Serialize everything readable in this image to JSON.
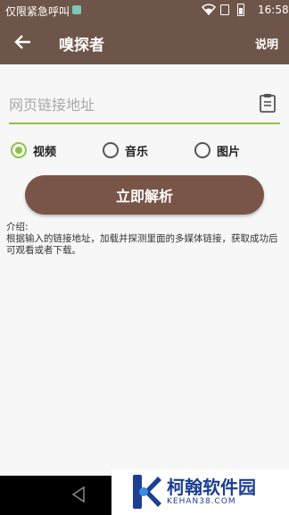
{
  "statusbar": {
    "carrier": "仅限紧急呼叫",
    "time": "16:58"
  },
  "appbar": {
    "title": "嗅探者",
    "help_label": "说明"
  },
  "url_field": {
    "placeholder": "网页链接地址",
    "value": ""
  },
  "media_types": [
    {
      "label": "视频",
      "checked": true
    },
    {
      "label": "音乐",
      "checked": false
    },
    {
      "label": "图片",
      "checked": false
    }
  ],
  "parse_button_label": "立即解析",
  "intro": {
    "heading": "介绍:",
    "body": "根据输入的链接地址，加载并探测里面的多媒体链接，获取成功后可观看或者下载。"
  },
  "watermark": {
    "name": "柯翰软件园",
    "url": "KEHAN38.COM"
  },
  "colors": {
    "appbar": "#6e554a",
    "accent": "#8bc34a",
    "button": "#795548"
  }
}
